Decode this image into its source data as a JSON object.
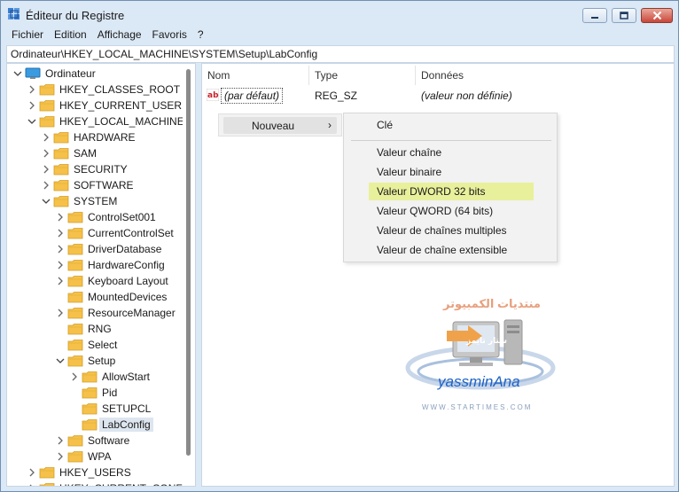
{
  "window": {
    "title": "Éditeur du Registre"
  },
  "menu": [
    "Fichier",
    "Edition",
    "Affichage",
    "Favoris",
    "?"
  ],
  "address": "Ordinateur\\HKEY_LOCAL_MACHINE\\SYSTEM\\Setup\\LabConfig",
  "tree": {
    "root": "Ordinateur",
    "items": [
      {
        "label": "HKEY_CLASSES_ROOT",
        "level": 1,
        "expanded": false
      },
      {
        "label": "HKEY_CURRENT_USER",
        "level": 1,
        "expanded": false
      },
      {
        "label": "HKEY_LOCAL_MACHINE",
        "level": 1,
        "expanded": true
      },
      {
        "label": "HARDWARE",
        "level": 2,
        "expanded": false
      },
      {
        "label": "SAM",
        "level": 2,
        "expanded": false
      },
      {
        "label": "SECURITY",
        "level": 2,
        "expanded": false
      },
      {
        "label": "SOFTWARE",
        "level": 2,
        "expanded": false
      },
      {
        "label": "SYSTEM",
        "level": 2,
        "expanded": true
      },
      {
        "label": "ControlSet001",
        "level": 3,
        "expanded": false
      },
      {
        "label": "CurrentControlSet",
        "level": 3,
        "expanded": false
      },
      {
        "label": "DriverDatabase",
        "level": 3,
        "expanded": false
      },
      {
        "label": "HardwareConfig",
        "level": 3,
        "expanded": false
      },
      {
        "label": "Keyboard Layout",
        "level": 3,
        "expanded": false
      },
      {
        "label": "MountedDevices",
        "level": 3,
        "expanded": null
      },
      {
        "label": "ResourceManager",
        "level": 3,
        "expanded": false
      },
      {
        "label": "RNG",
        "level": 3,
        "expanded": null
      },
      {
        "label": "Select",
        "level": 3,
        "expanded": null
      },
      {
        "label": "Setup",
        "level": 3,
        "expanded": true
      },
      {
        "label": "AllowStart",
        "level": 4,
        "expanded": false
      },
      {
        "label": "Pid",
        "level": 4,
        "expanded": null
      },
      {
        "label": "SETUPCL",
        "level": 4,
        "expanded": null
      },
      {
        "label": "LabConfig",
        "level": 4,
        "expanded": null,
        "selected": true
      },
      {
        "label": "Software",
        "level": 3,
        "expanded": false
      },
      {
        "label": "WPA",
        "level": 3,
        "expanded": false
      },
      {
        "label": "HKEY_USERS",
        "level": 1,
        "expanded": false
      },
      {
        "label": "HKEY_CURRENT_CONFIG",
        "level": 1,
        "expanded": false
      }
    ]
  },
  "columns": {
    "name": "Nom",
    "type": "Type",
    "data": "Données"
  },
  "values": [
    {
      "name": "(par défaut)",
      "type": "REG_SZ",
      "data": "(valeur non définie)"
    }
  ],
  "context_menu": {
    "item": "Nouveau",
    "arrow": "›",
    "submenu": [
      "Clé",
      "Valeur chaîne",
      "Valeur binaire",
      "Valeur DWORD 32 bits",
      "Valeur QWORD (64 bits)",
      "Valeur de chaînes multiples",
      "Valeur de chaîne extensible"
    ],
    "highlighted": "Valeur DWORD 32 bits"
  },
  "watermark": {
    "arabic": "منتديات الكمبيوتر",
    "name": "yassminAna",
    "site": "WWW.STARTIMES.COM"
  },
  "colors": {
    "highlight": "#e9f09c",
    "folder": "#f5c14a",
    "titlebar": "#dbe8f5"
  }
}
